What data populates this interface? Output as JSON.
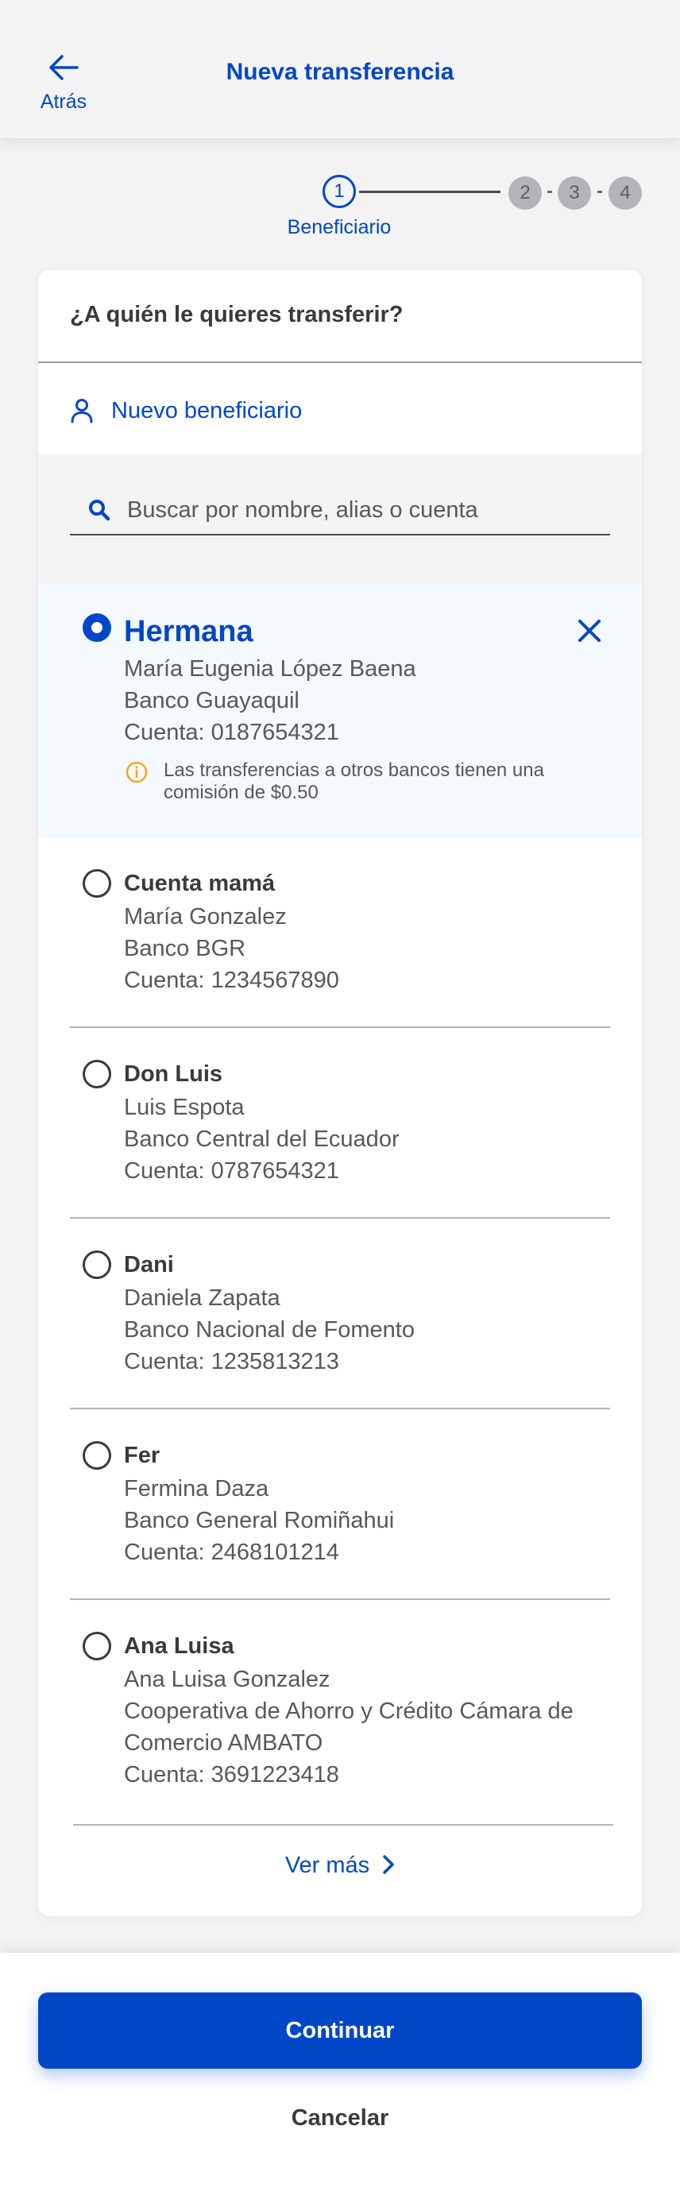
{
  "header": {
    "back_label": "Atrás",
    "title": "Nueva transferencia"
  },
  "stepper": {
    "steps": [
      "1",
      "2",
      "3",
      "4"
    ],
    "current_step_label": "Beneficiario"
  },
  "card": {
    "question": "¿A quién le quieres transferir?",
    "new_beneficiary_label": "Nuevo beneficiario",
    "search_placeholder": "Buscar por nombre, alias o cuenta"
  },
  "selected": {
    "alias": "Hermana",
    "name": "María Eugenia López Baena",
    "bank": "Banco Guayaquil",
    "account": "Cuenta: 0187654321",
    "notice": "Las transferencias a otros bancos tienen una comisión de $0.50"
  },
  "beneficiaries": [
    {
      "alias": "Cuenta mamá",
      "name": "María Gonzalez",
      "bank": "Banco BGR",
      "account": "Cuenta: 1234567890"
    },
    {
      "alias": "Don Luis",
      "name": "Luis Espota",
      "bank": "Banco Central del Ecuador",
      "account": "Cuenta: 0787654321"
    },
    {
      "alias": "Dani",
      "name": "Daniela Zapata",
      "bank": "Banco Nacional de Fomento",
      "account": "Cuenta: 1235813213"
    },
    {
      "alias": "Fer",
      "name": "Fermina Daza",
      "bank": "Banco General Romiñahui",
      "account": "Cuenta: 2468101214"
    },
    {
      "alias": "Ana Luisa",
      "name": "Ana Luisa Gonzalez",
      "bank_line1": "Cooperativa de Ahorro y Crédito Cámara de",
      "bank_line2": "Comercio AMBATO",
      "account": "Cuenta: 3691223418"
    }
  ],
  "ver_mas_label": "Ver más",
  "footer": {
    "continue_label": "Continuar",
    "cancel_label": "Cancelar"
  },
  "colors": {
    "primary": "#0047c7",
    "warning": "#f5a623",
    "selected_bg": "#f4f8ff"
  }
}
